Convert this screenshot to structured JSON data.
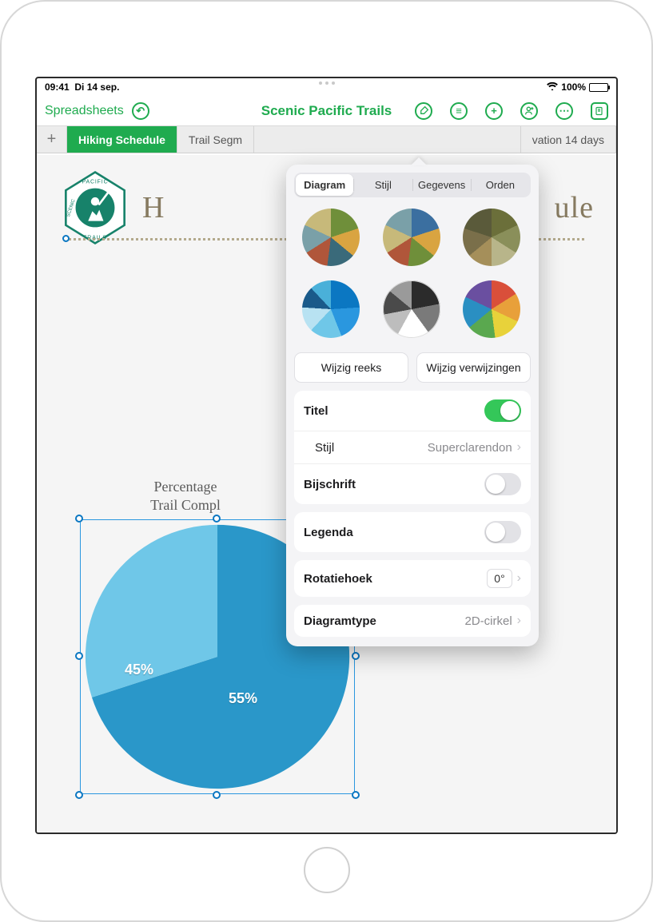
{
  "status": {
    "time": "09:41",
    "date": "Di 14 sep.",
    "battery": "100%",
    "signal_icon": "wifi"
  },
  "toolbar": {
    "back": "Spreadsheets",
    "title": "Scenic Pacific Trails",
    "icons": [
      "undo",
      "format-brush",
      "comment",
      "add",
      "collaborate",
      "more",
      "doc-settings"
    ]
  },
  "tabs": {
    "items": [
      "Hiking Schedule",
      "Trail Segm",
      "vation 14 days"
    ],
    "active_index": 0,
    "add_icon": "+"
  },
  "document": {
    "heading": "H",
    "heading_suffix": "ule",
    "logo": {
      "top": "PACIFIC",
      "left": "SCENIC",
      "bottom": "TRAILS",
      "fg": "#17826a",
      "bg": "#ffffff"
    }
  },
  "chart_data": {
    "type": "pie",
    "title": "Percentage\nTrail Compl",
    "slices": [
      {
        "label": "45%",
        "value": 45,
        "color": "#6fc7e8"
      },
      {
        "label": "55%",
        "value": 55,
        "color": "#2a97c9"
      }
    ]
  },
  "popover": {
    "tabs": [
      "Diagram",
      "Stijl",
      "Gegevens",
      "Orden"
    ],
    "active_tab": 0,
    "style_presets": [
      [
        [
          "#6f8f3a",
          "#d9a441",
          "#3a6a7a",
          "#b0563a",
          "#7aa0a8",
          "#c7b97a"
        ]
      ],
      [
        [
          "#3b6fa0",
          "#d9a441",
          "#6f8f3a",
          "#b0563a",
          "#c7b97a",
          "#7aa0a8"
        ]
      ],
      [
        [
          "#6b6f3a",
          "#8a8f5a",
          "#b8b58a",
          "#a58f5a",
          "#7a6f4a",
          "#5a5a3a"
        ]
      ],
      [
        [
          "#0b77c2",
          "#2a97df",
          "#6fc7e8",
          "#b8e2f2",
          "#1a5a8a",
          "#4ab0d9"
        ]
      ],
      [
        [
          "#2b2b2b",
          "#7a7a7a",
          "#ffffff",
          "#bdbdbd",
          "#4a4a4a",
          "#9a9a9a"
        ]
      ],
      [
        [
          "#d94f3a",
          "#e8a03a",
          "#e8d23a",
          "#5aa84f",
          "#2a8fc2",
          "#6a4fa0"
        ]
      ]
    ],
    "buttons": {
      "edit_series": "Wijzig reeks",
      "edit_refs": "Wijzig verwijzingen"
    },
    "rows": {
      "title_label": "Titel",
      "title_on": true,
      "style_label": "Stijl",
      "style_value": "Superclarendon",
      "caption_label": "Bijschrift",
      "caption_on": false,
      "legend_label": "Legenda",
      "legend_on": false,
      "rotation_label": "Rotatiehoek",
      "rotation_value": "0°",
      "type_label": "Diagramtype",
      "type_value": "2D-cirkel"
    }
  }
}
